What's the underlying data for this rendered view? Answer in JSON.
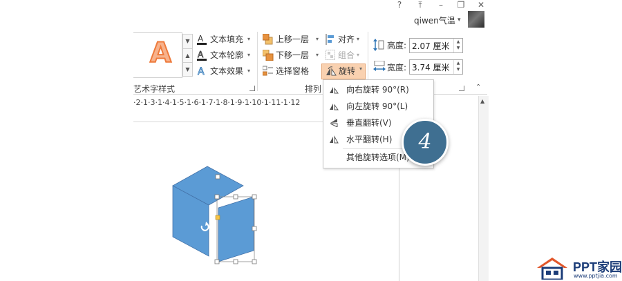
{
  "window": {
    "help_icon": "?",
    "restore_ribbon_icon": "⤒",
    "minimize_icon": "–",
    "restore_icon": "❐",
    "close_icon": "✕",
    "user_name": "qiwen气温",
    "user_caret": "▾"
  },
  "wordart": {
    "sample_letter": "A",
    "text_fill": "文本填充",
    "text_outline": "文本轮廓",
    "text_effects": "文本效果",
    "group_label": "艺术字样式"
  },
  "arrange": {
    "bring_forward": "上移一层",
    "send_backward": "下移一层",
    "selection_pane": "选择窗格",
    "align": "对齐",
    "group": "组合",
    "rotate": "旋转",
    "group_label": "排列"
  },
  "size": {
    "height_label": "高度:",
    "height_value": "2.07 厘米",
    "width_label": "宽度:",
    "width_value": "3.74 厘米"
  },
  "ruler": {
    "text": "·2·1·3·1·4·1·5·1·6·1·7·1·8·1·9·1·10·1·11·1·12"
  },
  "rotate_menu": {
    "items": [
      {
        "label": "向右旋转 90°(R)",
        "icon": "rotate-right-icon"
      },
      {
        "label": "向左旋转 90°(L)",
        "icon": "rotate-left-icon"
      },
      {
        "label": "垂直翻转(V)",
        "icon": "flip-vertical-icon"
      },
      {
        "label": "水平翻转(H)",
        "icon": "flip-horizontal-icon"
      },
      {
        "label": "其他旋转选项(M)...",
        "icon": ""
      }
    ]
  },
  "step_badge": "4",
  "footer": {
    "brand": "PPT家园",
    "url": "www.pptjia.com"
  },
  "colors": {
    "shape_fill": "#5b9bd5",
    "rotate_highlight": "#f9d1b0",
    "badge": "#3f6f91",
    "brand": "#1b3c78"
  }
}
